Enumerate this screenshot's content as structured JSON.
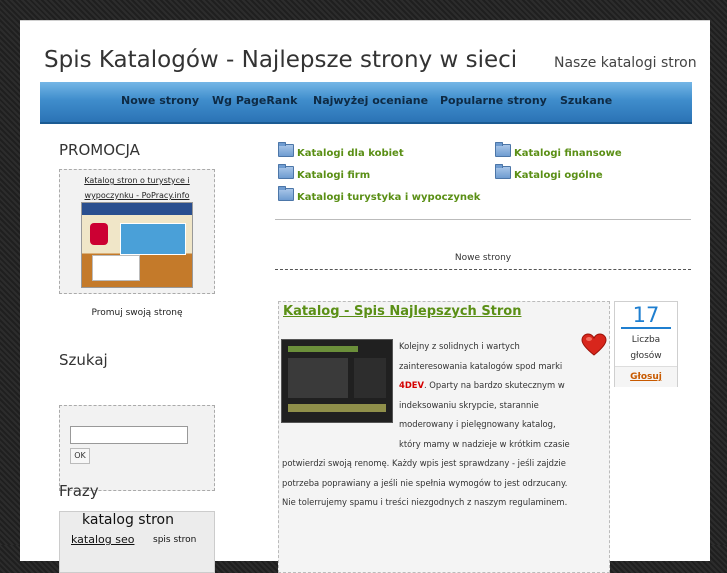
{
  "header": {
    "title": "Spis Katalogów - Najlepsze strony w sieci",
    "tagline": "Nasze katalogi stron"
  },
  "nav": {
    "items": [
      "Nowe strony",
      "Wg PageRank",
      "Najwyżej oceniane",
      "Popularne strony",
      "Szukane"
    ]
  },
  "sidebar": {
    "promo": {
      "heading": "PROMOCJA",
      "link_text": "Katalog stron o turystyce i wypoczynku - PoPracy.info",
      "caption": "Promuj swoją stronę"
    },
    "search": {
      "heading": "Szukaj",
      "input_value": "",
      "button_label": "OK"
    },
    "tags": {
      "heading": "Frazy",
      "items": [
        "katalog stron",
        "katalog seo",
        "spis stron"
      ]
    }
  },
  "categories": {
    "items": [
      "Katalogi dla kobiet",
      "Katalogi finansowe",
      "Katalogi firm",
      "Katalogi ogólne",
      "Katalogi turystyka i wypoczynek"
    ],
    "icon": "folder-icon"
  },
  "section": {
    "label": "Nowe strony"
  },
  "entry": {
    "title": "Katalog - Spis Najlepszych Stron",
    "text_before_brand": "Kolejny z solidnych i wartych zainteresowania katalogów spod marki ",
    "brand": "4DEV",
    "text_after_brand": ". Oparty na bardzo skutecznym w indeksowaniu skrypcie, starannie moderowany i pielęgnowany katalog, który mamy w nadzieje w krótkim czasie potwierdzi swoją renomę. Każdy wpis jest sprawdzany - jeśli zajdzie potrzeba poprawiany a jeśli nie spełnia wymogów to jest odrzucany. Nie tolerrujemy spamu i treści niezgodnych z naszym regulaminem.",
    "favorite_icon": "heart-icon"
  },
  "vote": {
    "count": "17",
    "label": "Liczba głosów",
    "button": "Głosuj"
  },
  "colors": {
    "accent_green": "#5a8f15",
    "nav_blue": "#3f8dcc",
    "vote_blue": "#1f7fd0",
    "brand_red": "#d40000"
  }
}
